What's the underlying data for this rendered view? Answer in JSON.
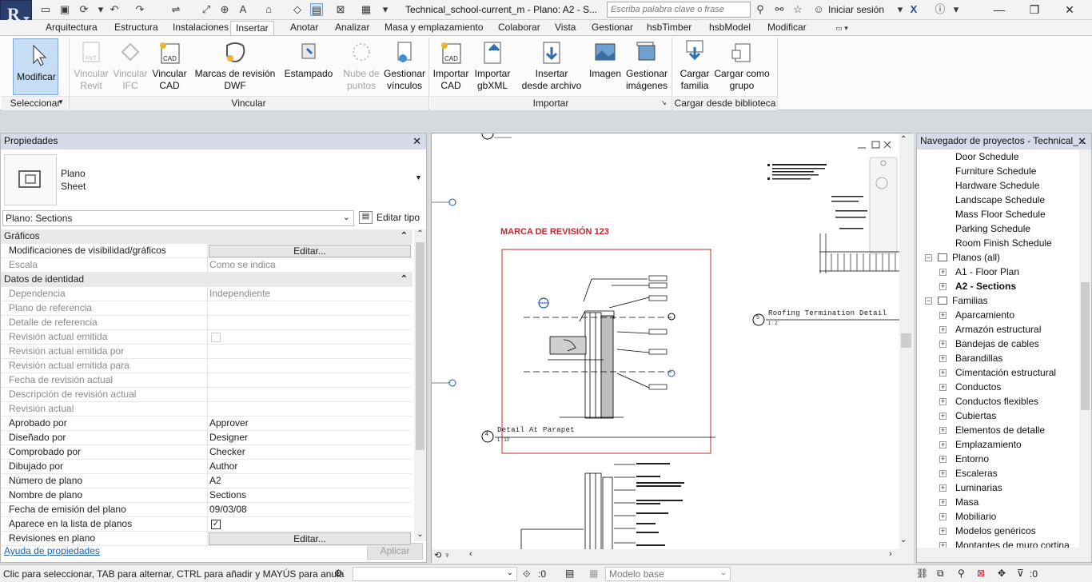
{
  "app": {
    "logo_letter": "R",
    "doc_title": "Technical_school-current_m - Plano: A2 - S...",
    "search_placeholder": "Escriba palabra clave o frase",
    "signin": "Iniciar sesión"
  },
  "tabs": [
    "Arquitectura",
    "Estructura",
    "Instalaciones",
    "Insertar",
    "Anotar",
    "Analizar",
    "Masa y emplazamiento",
    "Colaborar",
    "Vista",
    "Gestionar",
    "hsbTimber",
    "hsbModel",
    "Modificar"
  ],
  "active_tab": "Insertar",
  "ribbon": {
    "buttons": [
      {
        "l1": "Modificar",
        "l2": "",
        "enabled": true
      },
      {
        "l1": "Vincular",
        "l2": "Revit",
        "enabled": false
      },
      {
        "l1": "Vincular",
        "l2": "IFC",
        "enabled": false
      },
      {
        "l1": "Vincular",
        "l2": "CAD",
        "enabled": true
      },
      {
        "l1": "Marcas de revisión",
        "l2": "DWF",
        "enabled": true
      },
      {
        "l1": "Estampado",
        "l2": "",
        "enabled": true
      },
      {
        "l1": "Nube de",
        "l2": "puntos",
        "enabled": false
      },
      {
        "l1": "Gestionar",
        "l2": "vínculos",
        "enabled": true
      },
      {
        "l1": "Importar",
        "l2": "CAD",
        "enabled": true
      },
      {
        "l1": "Importar",
        "l2": "gbXML",
        "enabled": true
      },
      {
        "l1": "Insertar",
        "l2": "desde archivo",
        "enabled": true
      },
      {
        "l1": "Imagen",
        "l2": "",
        "enabled": true
      },
      {
        "l1": "Gestionar",
        "l2": "imágenes",
        "enabled": true
      },
      {
        "l1": "Cargar",
        "l2": "familia",
        "enabled": true
      },
      {
        "l1": "Cargar como",
        "l2": "grupo",
        "enabled": true
      }
    ],
    "panels": [
      "Seleccionar",
      "Vincular",
      "Importar",
      "Cargar desde biblioteca"
    ]
  },
  "properties": {
    "title": "Propiedades",
    "type_l1": "Plano",
    "type_l2": "Sheet",
    "selector": "Plano: Sections",
    "edit_type": "Editar tipo",
    "sections": [
      "Gráficos",
      "Datos de identidad"
    ],
    "rows": [
      {
        "k": "Modificaciones de visibilidad/gráficos",
        "v": "Editar...",
        "dim": false,
        "btn": true
      },
      {
        "k": "Escala",
        "v": "Como se indica",
        "dim": true
      },
      {
        "k": "Dependencia",
        "v": "Independiente",
        "dim": true
      },
      {
        "k": "Plano de referencia",
        "v": "",
        "dim": true
      },
      {
        "k": "Detalle de referencia",
        "v": "",
        "dim": true
      },
      {
        "k": "Revisión actual emitida",
        "v": "",
        "dim": true
      },
      {
        "k": "Revisión actual emitida por",
        "v": "",
        "dim": true
      },
      {
        "k": "Revisión actual emitida para",
        "v": "",
        "dim": true
      },
      {
        "k": "Fecha de revisión actual",
        "v": "",
        "dim": true
      },
      {
        "k": "Descripción de revisión actual",
        "v": "",
        "dim": true
      },
      {
        "k": "Revisión actual",
        "v": "",
        "dim": true
      },
      {
        "k": "Aprobado por",
        "v": "Approver",
        "dim": false
      },
      {
        "k": "Diseñado por",
        "v": "Designer",
        "dim": false
      },
      {
        "k": "Comprobado por",
        "v": "Checker",
        "dim": false
      },
      {
        "k": "Dibujado por",
        "v": "Author",
        "dim": false
      },
      {
        "k": "Número de plano",
        "v": "A2",
        "dim": false
      },
      {
        "k": "Nombre de plano",
        "v": "Sections",
        "dim": false
      },
      {
        "k": "Fecha de emisión del plano",
        "v": "09/03/08",
        "dim": false
      },
      {
        "k": "Aparece en la lista de planos",
        "v": "",
        "dim": false
      },
      {
        "k": "Revisiones en plano",
        "v": "Editar...",
        "dim": false,
        "btn": true
      }
    ],
    "help": "Ayuda de propiedades",
    "apply": "Aplicar"
  },
  "view": {
    "revision_title": "MARCA DE REVISIÓN 123",
    "detail1": "Detail At Parapet",
    "detail1_num": "4",
    "detail1_scale": "1 : 10",
    "detail2": "Roofing Termination Detail",
    "detail2_num": "5",
    "detail2_scale": "1 : 2"
  },
  "browser": {
    "title": "Navegador de proyectos - Technical_...",
    "items": [
      {
        "t": "Door Schedule",
        "lvl": 2,
        "plus": false,
        "bold": false
      },
      {
        "t": "Furniture Schedule",
        "lvl": 2,
        "plus": false,
        "bold": false
      },
      {
        "t": "Hardware Schedule",
        "lvl": 2,
        "plus": false,
        "bold": false
      },
      {
        "t": "Landscape Schedule",
        "lvl": 2,
        "plus": false,
        "bold": false
      },
      {
        "t": "Mass Floor Schedule",
        "lvl": 2,
        "plus": false,
        "bold": false
      },
      {
        "t": "Parking Schedule",
        "lvl": 2,
        "plus": false,
        "bold": false
      },
      {
        "t": "Room Finish Schedule",
        "lvl": 2,
        "plus": false,
        "bold": false
      },
      {
        "t": "Planos (all)",
        "lvl": 1,
        "plus": true,
        "bold": false,
        "minus": true
      },
      {
        "t": "A1 - Floor Plan",
        "lvl": 2,
        "plus": true,
        "bold": false
      },
      {
        "t": "A2 - Sections",
        "lvl": 2,
        "plus": true,
        "bold": true
      },
      {
        "t": "Familias",
        "lvl": 1,
        "plus": true,
        "bold": false,
        "minus": true
      },
      {
        "t": "Aparcamiento",
        "lvl": 2,
        "plus": true,
        "bold": false
      },
      {
        "t": "Armazón estructural",
        "lvl": 2,
        "plus": true,
        "bold": false
      },
      {
        "t": "Bandejas de cables",
        "lvl": 2,
        "plus": true,
        "bold": false
      },
      {
        "t": "Barandillas",
        "lvl": 2,
        "plus": true,
        "bold": false
      },
      {
        "t": "Cimentación estructural",
        "lvl": 2,
        "plus": true,
        "bold": false
      },
      {
        "t": "Conductos",
        "lvl": 2,
        "plus": true,
        "bold": false
      },
      {
        "t": "Conductos flexibles",
        "lvl": 2,
        "plus": true,
        "bold": false
      },
      {
        "t": "Cubiertas",
        "lvl": 2,
        "plus": true,
        "bold": false
      },
      {
        "t": "Elementos de detalle",
        "lvl": 2,
        "plus": true,
        "bold": false
      },
      {
        "t": "Emplazamiento",
        "lvl": 2,
        "plus": true,
        "bold": false
      },
      {
        "t": "Entorno",
        "lvl": 2,
        "plus": true,
        "bold": false
      },
      {
        "t": "Escaleras",
        "lvl": 2,
        "plus": true,
        "bold": false
      },
      {
        "t": "Luminarias",
        "lvl": 2,
        "plus": true,
        "bold": false
      },
      {
        "t": "Masa",
        "lvl": 2,
        "plus": true,
        "bold": false
      },
      {
        "t": "Mobiliario",
        "lvl": 2,
        "plus": true,
        "bold": false
      },
      {
        "t": "Modelos genéricos",
        "lvl": 2,
        "plus": true,
        "bold": false
      },
      {
        "t": "Montantes de muro cortina",
        "lvl": 2,
        "plus": true,
        "bold": false
      }
    ]
  },
  "status": {
    "message": "Clic para seleccionar, TAB para alternar, CTRL para añadir y MAYÚS para anula",
    "count": ":0",
    "model": "Modelo base",
    "filter_count": ":0"
  },
  "colors": {
    "accent": "#2a3f6e",
    "revision": "#c0282d",
    "tab_header": "#d6dbe9"
  }
}
